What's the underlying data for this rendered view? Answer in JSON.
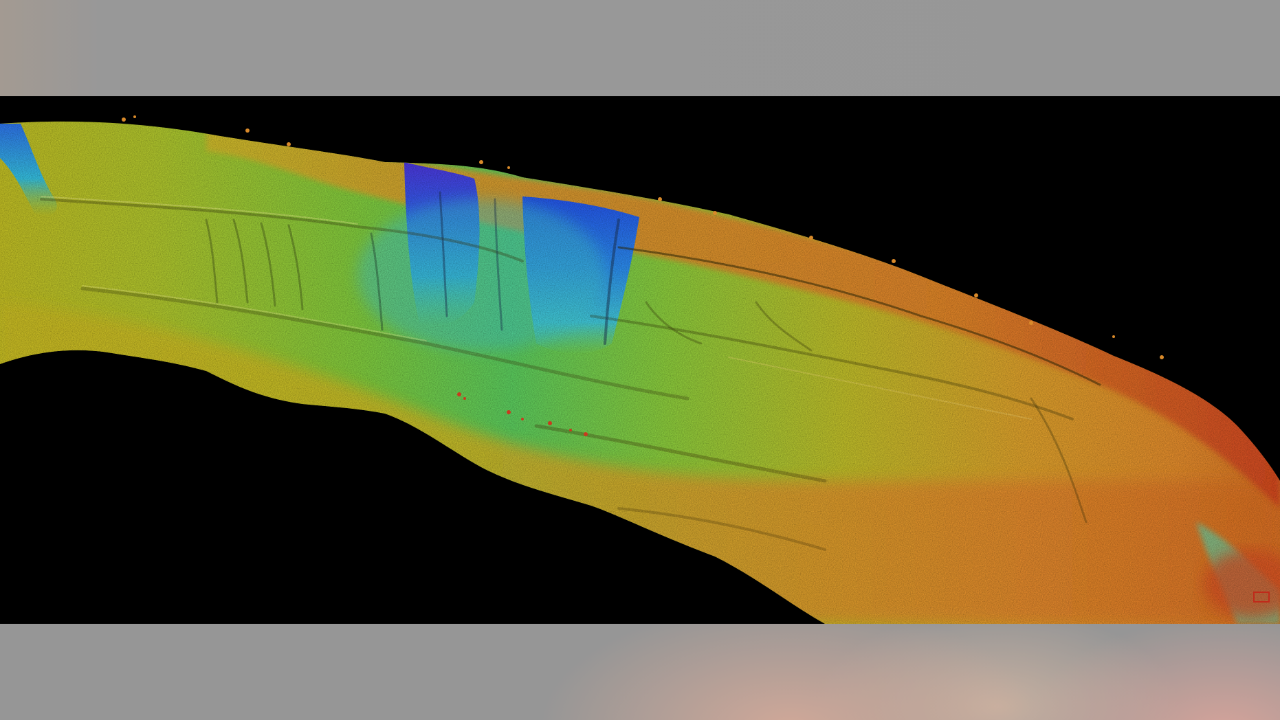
{
  "image": {
    "subject": "bathymetry-relief-map",
    "colors": {
      "background": "#000000",
      "frame_gray": "#979797",
      "deep_violet": "#4a2fd0",
      "deep_blue": "#1f6fe0",
      "cyan": "#35c6d2",
      "green": "#8fc63a",
      "yellow": "#c9c02a",
      "orange": "#d9822a",
      "red": "#c93a1e"
    }
  }
}
